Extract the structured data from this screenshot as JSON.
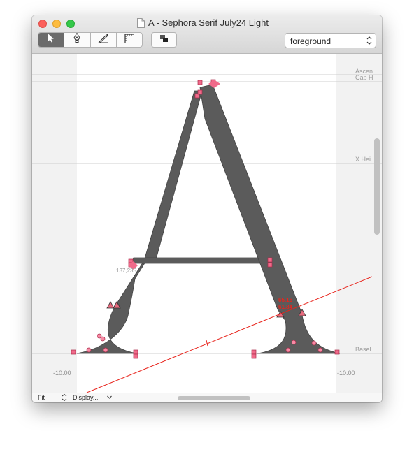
{
  "window": {
    "title": "A - Sephora Serif July24 Light"
  },
  "toolbar": {
    "tools": [
      {
        "icon": "pointer-icon",
        "active": true
      },
      {
        "icon": "pen-icon",
        "active": false
      },
      {
        "icon": "knife-icon",
        "active": false
      },
      {
        "icon": "measure-icon",
        "active": false
      }
    ],
    "layers_icon": "layers-icon",
    "layer_select": {
      "value": "foreground",
      "icon": "updown-chevron-icon"
    }
  },
  "metrics": {
    "ascender": "Ascen",
    "cap_height": "Cap H",
    "x_height": "X Hei",
    "baseline": "Basel"
  },
  "sidebearings": {
    "left": "-10.00",
    "right": "-10.00"
  },
  "measurements": {
    "crossbar_point": "137,235",
    "ruler_line1": "65.16",
    "ruler_line2": "61.84"
  },
  "statusbar": {
    "zoom": "Fit",
    "display": "Display..."
  },
  "colors": {
    "glyph_fill": "#5b5b5b",
    "node_color": "#f06a8a",
    "measure_color": "#e8241c",
    "titlebar": "#e4e4e4"
  }
}
